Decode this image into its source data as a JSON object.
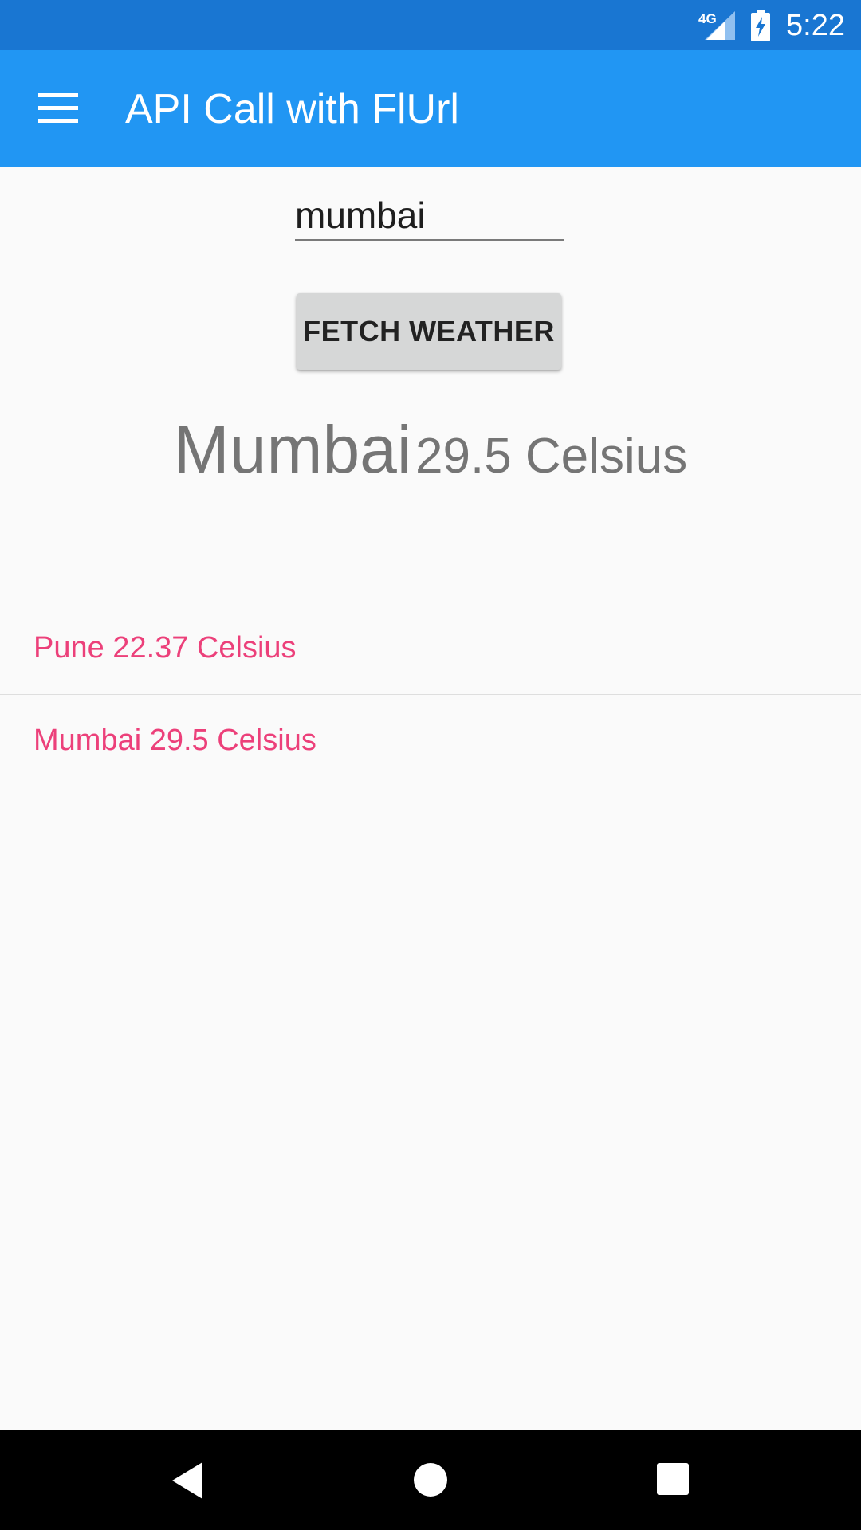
{
  "status_bar": {
    "network": "4G",
    "time": "5:22",
    "signal_icon": "cell-signal-icon",
    "battery_icon": "battery-charging-icon"
  },
  "app_bar": {
    "title": "API Call with FlUrl",
    "menu_icon": "hamburger-menu-icon"
  },
  "search": {
    "value": "mumbai"
  },
  "fetch_button": {
    "label": "FETCH WEATHER"
  },
  "result": {
    "city": "Mumbai",
    "temperature": "29.5 Celsius"
  },
  "history": [
    {
      "text": "Pune 22.37 Celsius"
    },
    {
      "text": "Mumbai 29.5 Celsius"
    }
  ],
  "nav_bar": {
    "back_icon": "back-triangle-icon",
    "home_icon": "home-circle-icon",
    "recents_icon": "recents-square-icon"
  },
  "colors": {
    "status_bar": "#1976d2",
    "app_bar": "#2196f3",
    "history_text": "#ec407a",
    "result_text": "#757575"
  }
}
